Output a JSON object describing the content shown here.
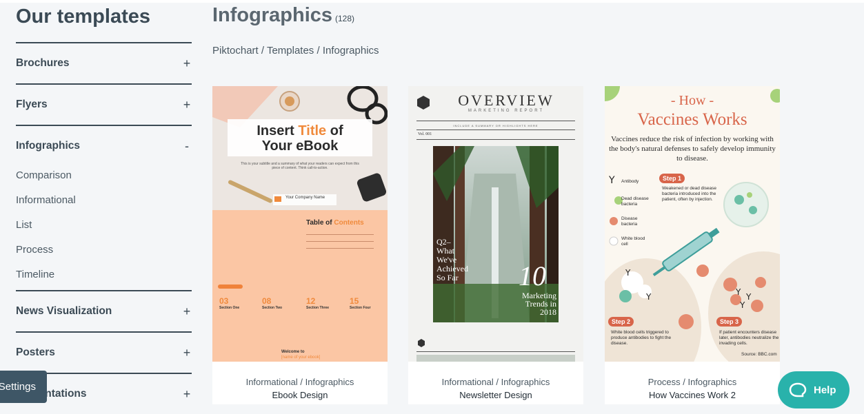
{
  "sidebar": {
    "title": "Our templates",
    "sections": [
      {
        "label": "Brochures",
        "toggle": "+"
      },
      {
        "label": "Flyers",
        "toggle": "+"
      },
      {
        "label": "Infographics",
        "toggle": "-",
        "sub": [
          "Comparison",
          "Informational",
          "List",
          "Process",
          "Timeline"
        ]
      },
      {
        "label": "News Visualization",
        "toggle": "+"
      },
      {
        "label": "Posters",
        "toggle": "+"
      },
      {
        "label": "Presentations",
        "toggle": "+"
      }
    ]
  },
  "main": {
    "title": "Infographics",
    "count": "(128)",
    "breadcrumb": [
      "Piktochart",
      "Templates",
      "Infographics"
    ],
    "breadcrumb_sep": " / "
  },
  "cards": [
    {
      "category": "Informational / Infographics",
      "name": "Ebook Design",
      "thumb": {
        "title_a": "Insert ",
        "title_b": "Title",
        "title_c": " of",
        "title_d": "Your eBook",
        "subtitle": "This is your subtitle and a summary of what your readers can expect from this piece of content. Think call-to-action.",
        "company": "Your Company Name",
        "toc_a": "Table of ",
        "toc_b": "Contents",
        "nums": [
          "03",
          "08",
          "12",
          "15"
        ],
        "sections": [
          "Section One",
          "Section Two",
          "Section Three",
          "Section Four"
        ],
        "welcome": "Welcome to",
        "welcome_b": "[name of your ebook]"
      }
    },
    {
      "category": "Informational / Infographics",
      "name": "Newsletter Design",
      "thumb": {
        "title": "OVERVIEW",
        "subtitle": "MARKETING REPORT",
        "strap": "INCLUDE A SUMMARY OR HIGHLIGHTS HERE",
        "vol": "Vol. 001",
        "left_text": "Q2–\nWhat\nWe've\nAchieved\nSo Far",
        "big_number": "10",
        "small_text": "Marketing Trends in 2018"
      }
    },
    {
      "category": "Process / Infographics",
      "name": "How Vaccines Work 2",
      "thumb": {
        "how": "- How -",
        "title": "Vaccines Works",
        "desc": "Vaccines reduce the risk of infection by working with the body's natural defenses to safely develop immunity to disease.",
        "legend": [
          "Antibody",
          "Dead disease bacteria",
          "Disease bacteria",
          "White blood cell"
        ],
        "step1": "Step 1",
        "step1_text": "Weakened or dead disease bacteria introduced into the patient, often by injection.",
        "step2": "Step 2",
        "step2_text": "White blood cells triggered to produce antibodies to fight the disease.",
        "step3": "Step 3",
        "step3_text": "If patient encounters disease later, antibodies neutralize the invading cells.",
        "source": "Source: BBC.com"
      }
    }
  ],
  "settings_label": "Settings",
  "help_label": "Help",
  "colors": {
    "accent": "#29b2ab",
    "heading": "#3b4a55",
    "settings_bg": "#3e5666",
    "orange": "#f08a3c",
    "vaccine_red": "#d8654a"
  }
}
